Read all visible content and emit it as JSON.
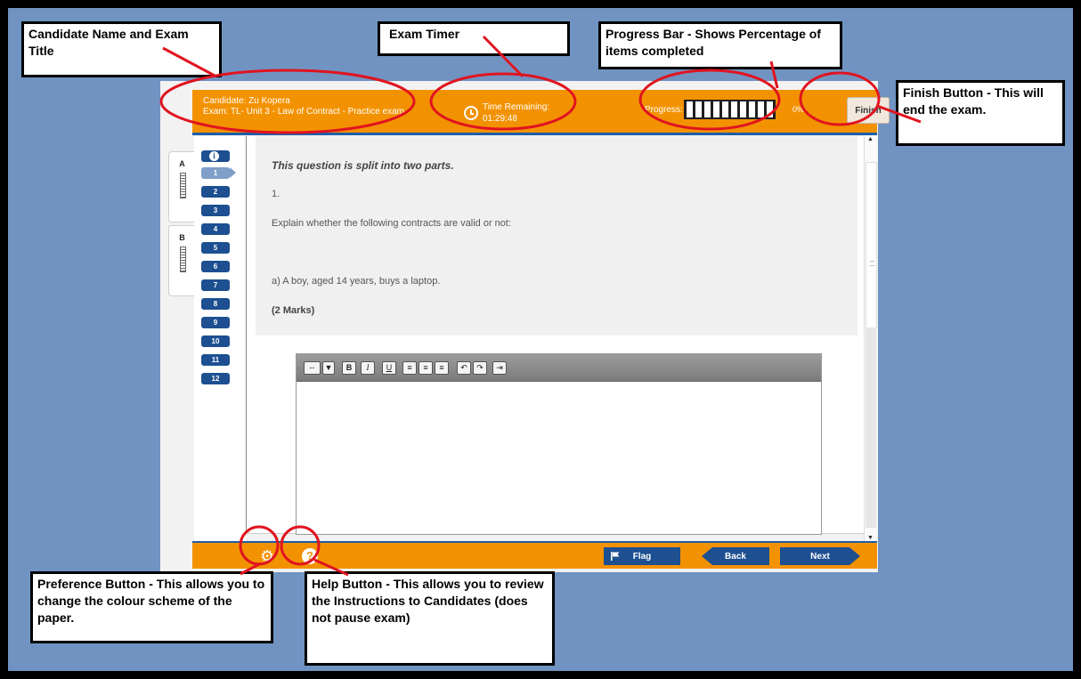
{
  "header": {
    "candidate_line": "Candidate: Zu Kopera",
    "exam_line": "Exam: TL- Unit 3 - Law of Contract - Practice exam",
    "timer_label": "Time Remaining:",
    "timer_value": "01:29:48",
    "progress_label": "Progress:",
    "progress_percent": "0%",
    "progress_value": 0,
    "finish_label": "Finish"
  },
  "sections": [
    {
      "label": "A"
    },
    {
      "label": "B"
    }
  ],
  "question_nav": {
    "info_icon": "info-icon",
    "items": [
      "1",
      "2",
      "3",
      "4",
      "5",
      "6",
      "7",
      "8",
      "9",
      "10",
      "11",
      "12"
    ],
    "active": "1"
  },
  "question": {
    "intro": "This question is split into two parts.",
    "number": "1.",
    "explain": "Explain whether the following contracts are valid or not:",
    "part_a": "a) A boy, aged 14 years, buys a laptop.",
    "marks": "(2 Marks)"
  },
  "editor_toolbar": {
    "format_select": "--",
    "buttons": [
      "B",
      "I",
      "U",
      "align-left-icon",
      "align-center-icon",
      "align-right-icon",
      "undo-icon",
      "redo-icon",
      "indent-icon"
    ]
  },
  "footer": {
    "preferences_icon": "gear-icon",
    "help_icon": "question-mark-icon",
    "flag_label": "Flag",
    "back_label": "Back",
    "next_label": "Next"
  },
  "annotations": {
    "candidate": "Candidate Name and Exam Title",
    "timer": "Exam Timer",
    "progress": "Progress Bar - Shows Percentage of items completed",
    "finish": "Finish Button - This will end the exam.",
    "preference": "Preference Button - This allows you to change the colour scheme of the paper.",
    "help": "Help Button - This allows you to review the Instructions to Candidates (does not pause exam)"
  },
  "colors": {
    "background": "#7193c2",
    "header_orange": "#f39200",
    "nav_blue": "#1d4f91",
    "annotation_red": "#e0141f"
  }
}
